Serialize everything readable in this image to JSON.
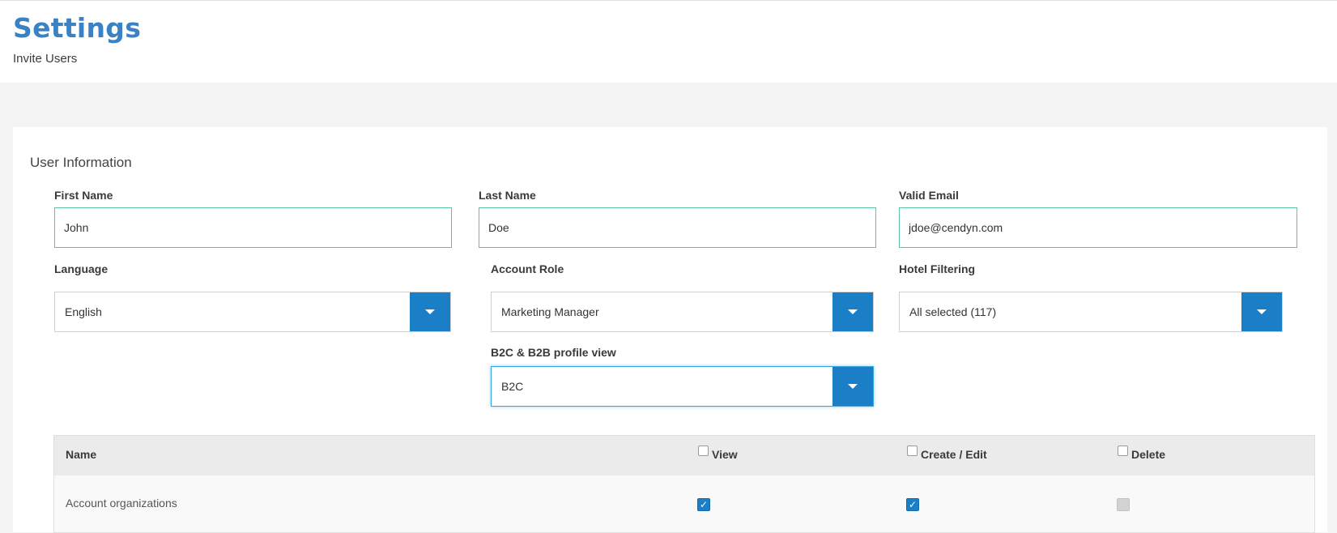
{
  "header": {
    "title": "Settings",
    "subtitle": "Invite Users"
  },
  "user_info": {
    "section_title": "User Information",
    "first_name": {
      "label": "First Name",
      "value": "John"
    },
    "last_name": {
      "label": "Last Name",
      "value": "Doe"
    },
    "email": {
      "label": "Valid Email",
      "value": "jdoe@cendyn.com"
    },
    "language": {
      "label": "Language",
      "value": "English"
    },
    "account_role": {
      "label": "Account Role",
      "value": "Marketing Manager"
    },
    "hotel_filtering": {
      "label": "Hotel Filtering",
      "value": "All selected (117)"
    },
    "profile_view": {
      "label": "B2C & B2B profile view",
      "value": "B2C"
    }
  },
  "permissions": {
    "columns": {
      "name": "Name",
      "view": "View",
      "create_edit": "Create / Edit",
      "delete": "Delete"
    },
    "header_checks": {
      "view": false,
      "create_edit": false,
      "delete": false
    },
    "rows": [
      {
        "name": "Account organizations",
        "view": "checked",
        "create_edit": "checked",
        "delete": "disabled"
      }
    ]
  },
  "colors": {
    "title": "#3a82c3",
    "accent": "#1a7fc6",
    "input_border": "#5bc4a5",
    "focus": "#37a4e0"
  }
}
